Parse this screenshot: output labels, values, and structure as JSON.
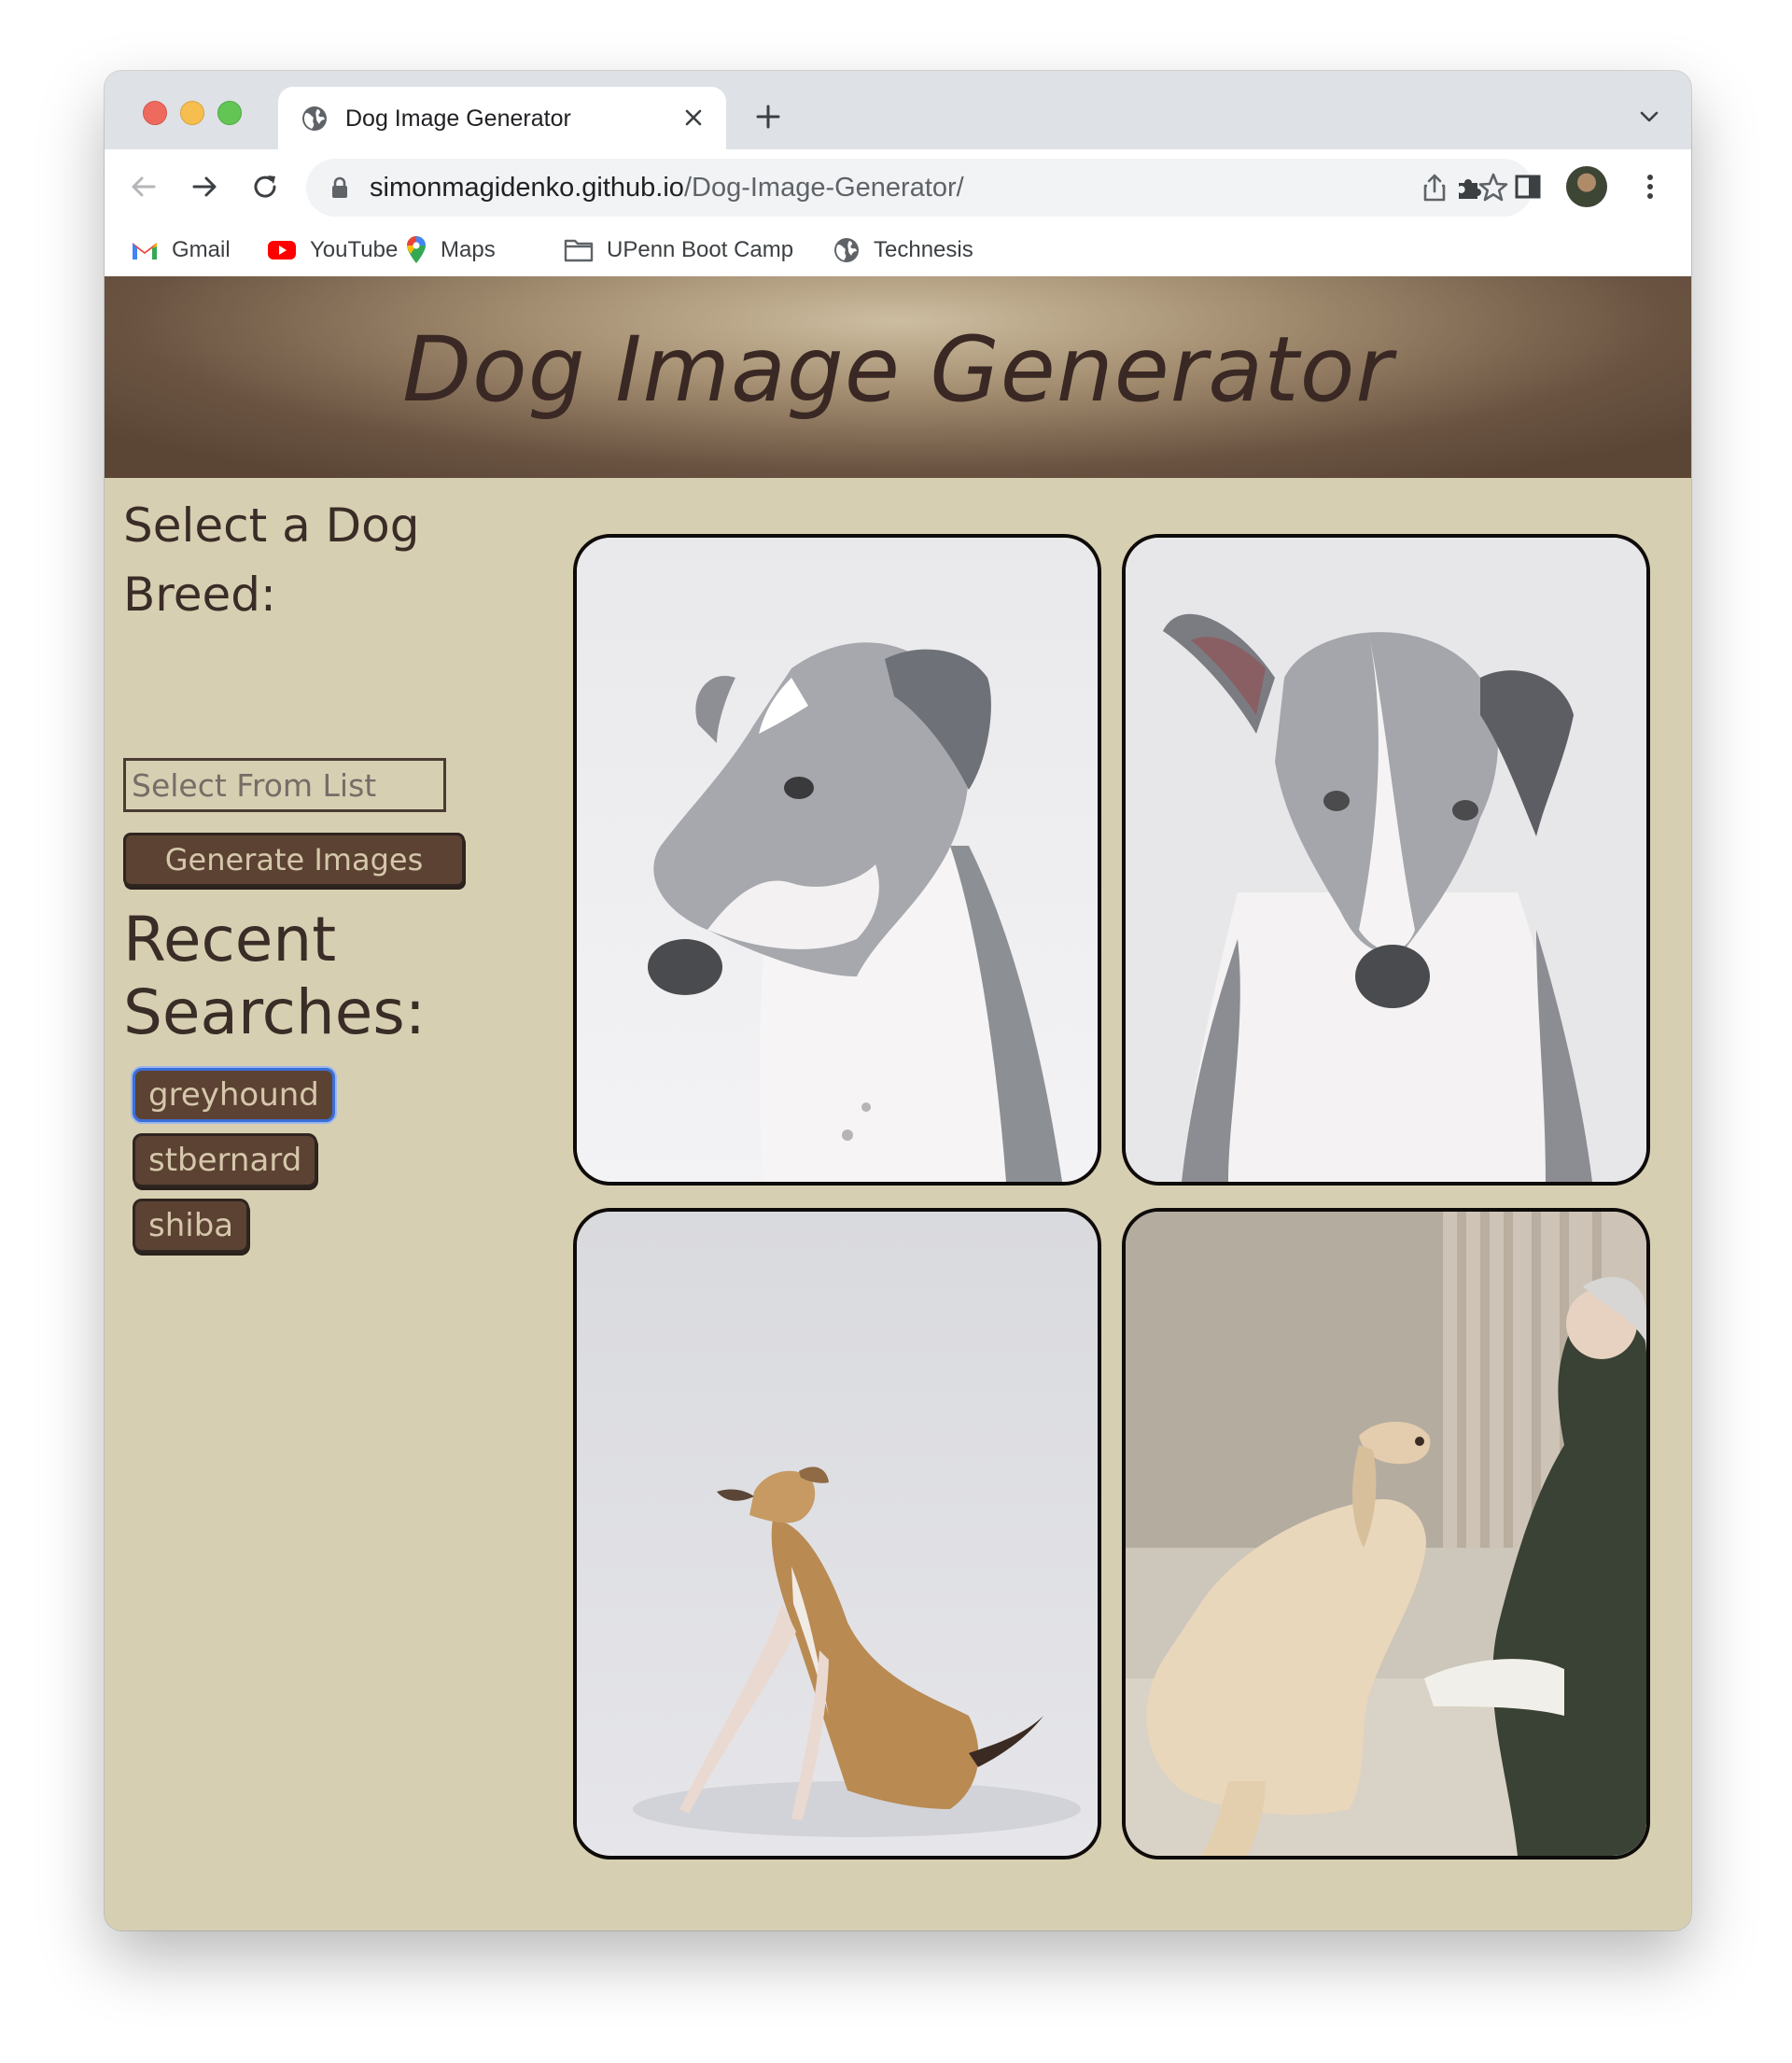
{
  "browser": {
    "tab_title": "Dog Image Generator",
    "url_host": "simonmagidenko.github.io",
    "url_path": "/Dog-Image-Generator/",
    "bookmarks": [
      {
        "label": "Gmail",
        "icon": "gmail-icon"
      },
      {
        "label": "YouTube",
        "icon": "youtube-icon"
      },
      {
        "label": "Maps",
        "icon": "maps-icon"
      },
      {
        "label": "UPenn Boot Camp",
        "icon": "folder-icon"
      },
      {
        "label": "Technesis",
        "icon": "globe-icon"
      }
    ]
  },
  "header": {
    "title": "Dog Image Generator"
  },
  "sidebar": {
    "select_heading_line1": "Select a Dog",
    "select_heading_line2": "Breed:",
    "input_placeholder": "Select From List",
    "generate_label": "Generate Images",
    "recent_heading_line1": "Recent",
    "recent_heading_line2": "Searches:",
    "recent": [
      "greyhound",
      "stbernard",
      "shiba"
    ]
  },
  "gallery": {
    "images": [
      {
        "alt": "grey and white greyhound portrait facing left"
      },
      {
        "alt": "grey and white greyhound portrait facing forward"
      },
      {
        "alt": "tan and white italian greyhound sitting"
      },
      {
        "alt": "cream long-haired dog beside a woman on a sofa"
      }
    ]
  },
  "colors": {
    "page_bg": "#d7cfb2",
    "button_bg": "#5c4233",
    "heading_text": "#3a2c26",
    "active_focus": "#3b6fd8"
  }
}
